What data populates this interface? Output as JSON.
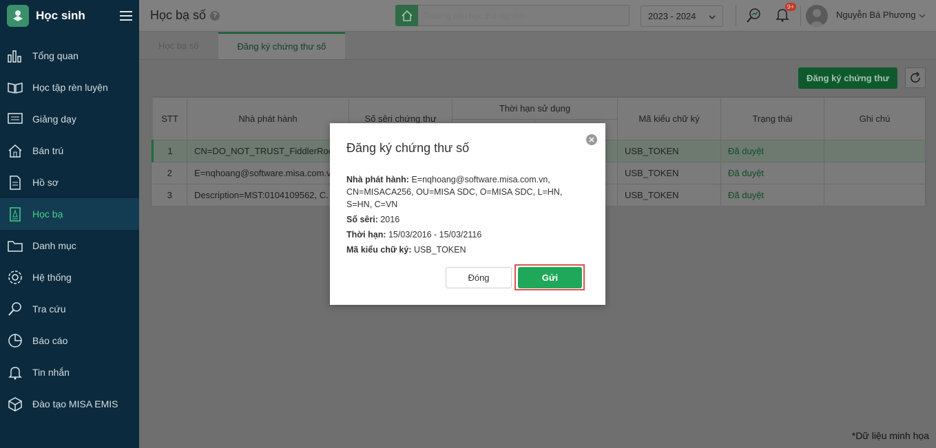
{
  "sidebar": {
    "app_title": "Học sinh",
    "items": [
      {
        "label": "Tổng quan",
        "icon": "chart-bars-icon"
      },
      {
        "label": "Học tập rèn luyện",
        "icon": "book-open-icon"
      },
      {
        "label": "Giảng dạy",
        "icon": "monitor-icon"
      },
      {
        "label": "Bán trú",
        "icon": "home-icon"
      },
      {
        "label": "Hồ sơ",
        "icon": "document-icon"
      },
      {
        "label": "Học bạ",
        "icon": "report-book-icon",
        "active": true
      },
      {
        "label": "Danh mục",
        "icon": "folder-icon"
      },
      {
        "label": "Hệ thống",
        "icon": "gear-icon"
      },
      {
        "label": "Tra cứu",
        "icon": "search-icon"
      },
      {
        "label": "Báo cáo",
        "icon": "pie-chart-icon"
      },
      {
        "label": "Tin nhắn",
        "icon": "bell-icon"
      },
      {
        "label": "Đào tạo MISA EMIS",
        "icon": "cube-icon"
      }
    ]
  },
  "header": {
    "page_title": "Học bạ số",
    "search_placeholder": "Trường tiểu học thử nghiệm",
    "school_year": "2023 - 2024",
    "notification_badge": "9+",
    "user_name": "Nguyễn Bá Phương"
  },
  "tabs": [
    {
      "label": "Học bạ số",
      "active": false
    },
    {
      "label": "Đăng ký chứng thư số",
      "active": true
    }
  ],
  "toolbar": {
    "register_label": "Đăng ký chứng thư"
  },
  "table": {
    "columns": {
      "stt": "STT",
      "issuer": "Nhà phát hành",
      "serial": "Số sêri chứng thư",
      "validity": "Thời hạn sử dụng",
      "sign_type": "Mã kiểu chữ ký",
      "status": "Trạng thái",
      "note": "Ghi chú"
    },
    "rows": [
      {
        "stt": "1",
        "issuer": "CN=DO_NOT_TRUST_FiddlerRoot",
        "sign_type": "USB_TOKEN",
        "status": "Đã duyệt"
      },
      {
        "stt": "2",
        "issuer": "E=nqhoang@software.misa.com.vn",
        "sign_type": "USB_TOKEN",
        "status": "Đã duyệt"
      },
      {
        "stt": "3",
        "issuer": "Description=MST:0104109562, C.",
        "sign_type": "USB_TOKEN",
        "status": "Đã duyệt"
      }
    ]
  },
  "footnote": "*Dữ liệu minh họa",
  "modal": {
    "title": "Đăng ký chứng thư số",
    "issuer_label": "Nhà phát hành:",
    "issuer_value": "E=nqhoang@software.misa.com.vn, CN=MISACA256, OU=MISA SDC, O=MISA SDC, L=HN, S=HN, C=VN",
    "serial_label": "Số sêri:",
    "serial_value": "2016",
    "validity_label": "Thời hạn:",
    "validity_value": "15/03/2016 - 15/03/2116",
    "sign_type_label": "Mã kiểu chữ ký:",
    "sign_type_value": "USB_TOKEN",
    "close_label": "Đóng",
    "send_label": "Gửi"
  },
  "colors": {
    "sidebar_bg": "#0b2a3d",
    "accent_green": "#1fa859",
    "highlight_red": "#d9534f"
  }
}
